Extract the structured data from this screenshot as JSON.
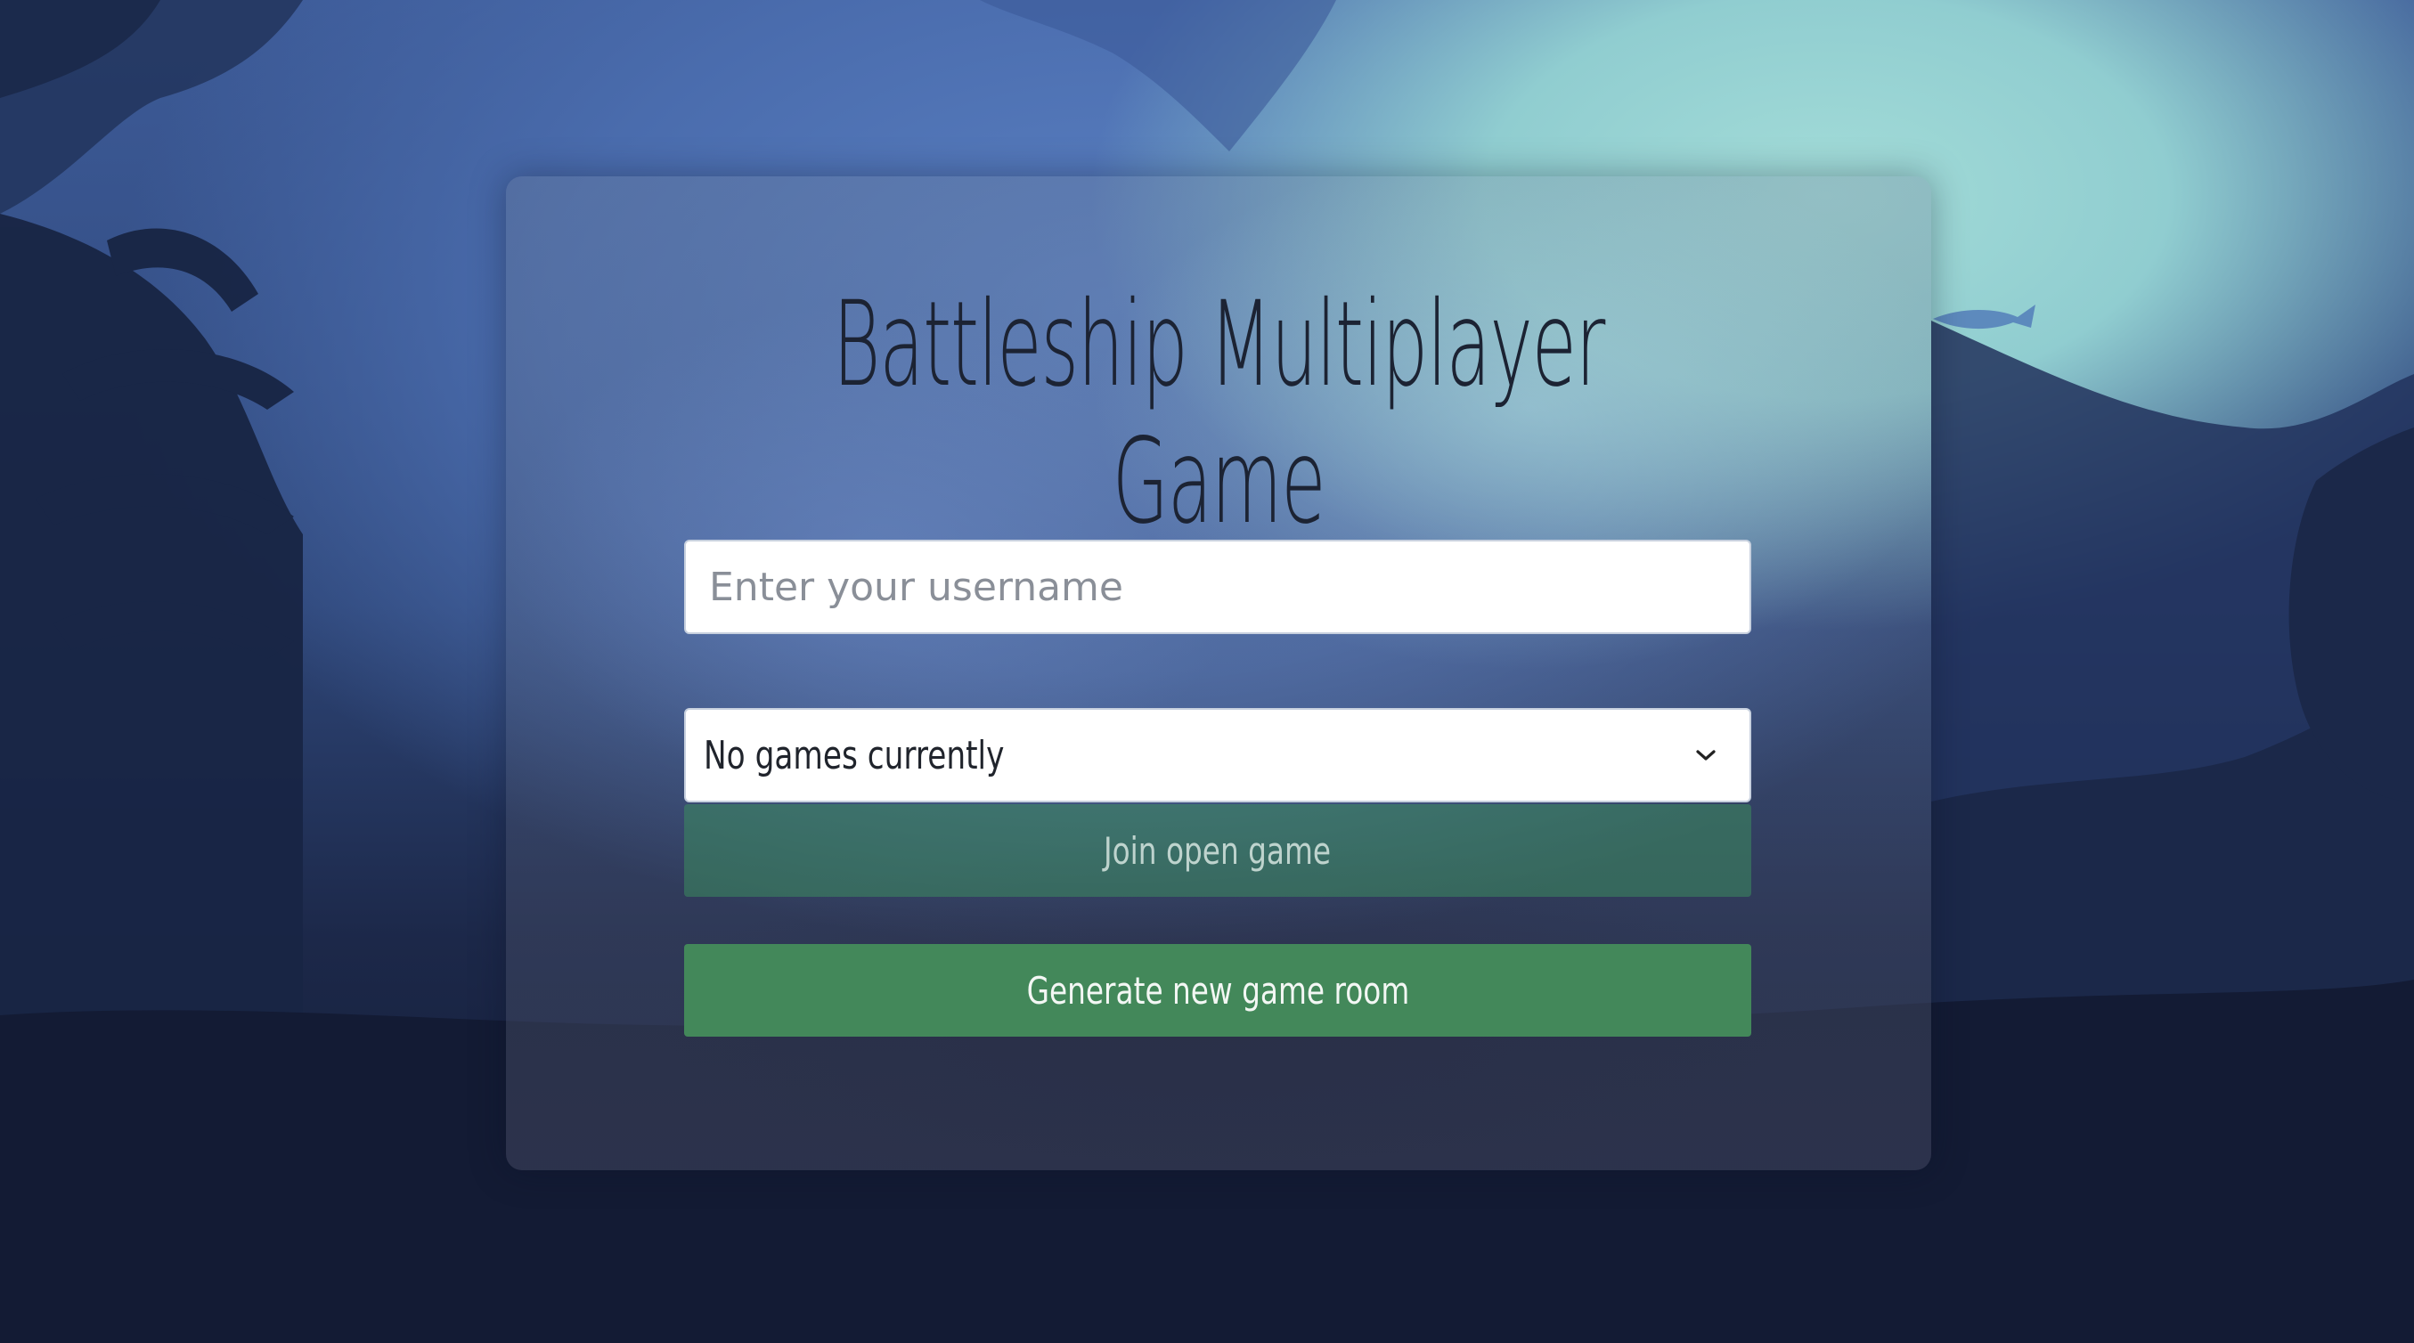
{
  "title": "Battleship Multiplayer Game",
  "username_input": {
    "placeholder": "Enter your username",
    "value": ""
  },
  "games_select": {
    "selected": "No games currently"
  },
  "buttons": {
    "join": "Join open game",
    "generate": "Generate new game room"
  },
  "colors": {
    "button_green": "#43885a",
    "title_text": "#1c2333",
    "background_dark": "#121a33"
  }
}
